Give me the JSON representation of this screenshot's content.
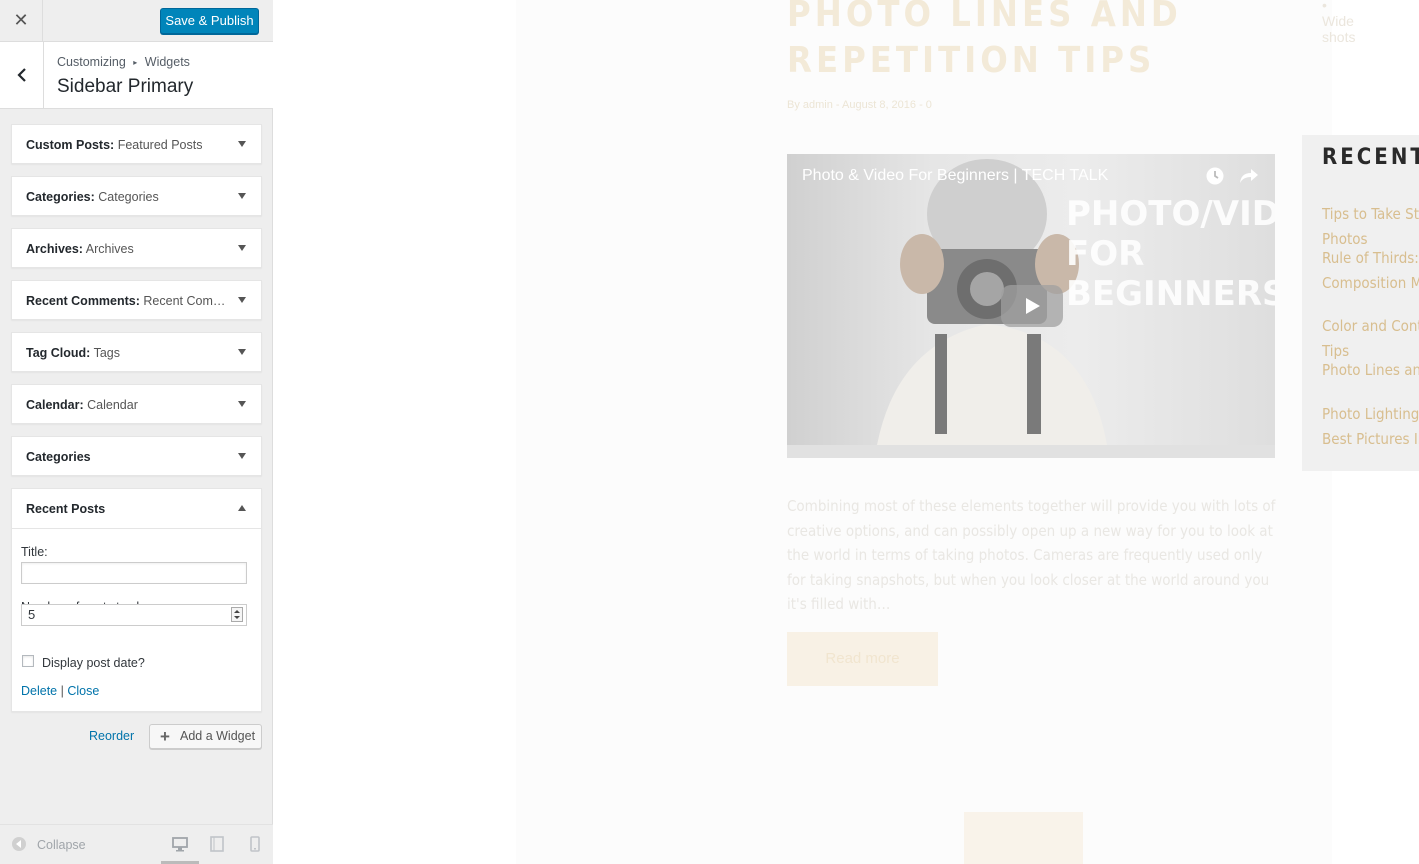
{
  "customizer": {
    "close_label": "✕",
    "save_label": "Save & Publish",
    "breadcrumb": [
      "Customizing",
      "Widgets"
    ],
    "breadcrumb_sep": "▸",
    "section_title": "Sidebar Primary",
    "widgets": [
      {
        "type": "Custom Posts:",
        "name": "Featured Posts"
      },
      {
        "type": "Categories:",
        "name": "Categories"
      },
      {
        "type": "Archives:",
        "name": "Archives"
      },
      {
        "type": "Recent Comments:",
        "name": "Recent Com…"
      },
      {
        "type": "Tag Cloud:",
        "name": "Tags"
      },
      {
        "type": "Calendar:",
        "name": "Calendar"
      },
      {
        "type": "Categories",
        "name": ""
      }
    ],
    "expanded_widget": {
      "type": "Recent Posts",
      "title_label": "Title:",
      "title_value": "",
      "number_label": "Number of posts to show:",
      "number_value": "5",
      "display_date_label": "Display post date?",
      "delete_label": "Delete",
      "separator": "|",
      "close_label": "Close"
    },
    "reorder_label": "Reorder",
    "add_widget_label": "Add a Widget",
    "collapse_label": "Collapse"
  },
  "preview": {
    "post_title": "Photo Lines and Repetition Tips",
    "post_meta": "By admin - August 8, 2016 - 0",
    "video_title": "Photo & Video For Beginners | TECH TALK",
    "video_overlay": [
      "PHOTO/VIDEO",
      "FOR",
      "BEGINNERS"
    ],
    "excerpt": "Combining most of these elements together will provide you with lots of creative options, and can possibly open up a new way for you to look at the world in terms of taking photos. Cameras are frequently used only for taking snapshots, but when you look closer at the world around you it's filled with…",
    "read_more": "Read more",
    "sidebar_top_item": "• Wide shots",
    "recent_posts_title": "RECENT POSTS",
    "recent_posts": [
      "Tips to Take Stunning Portrait Photos",
      "Rule of Thirds: A Photo Composition Must Have Skill",
      "Color and Contrast Photography Tips",
      "Photo Lines and Repetition Tips",
      "Photo Lighting: How to Take Your Best Pictures Inside and Outside"
    ]
  },
  "colors": {
    "primary_button": "#0085ba",
    "link": "#0073aa",
    "accent": "#d8be8f"
  }
}
